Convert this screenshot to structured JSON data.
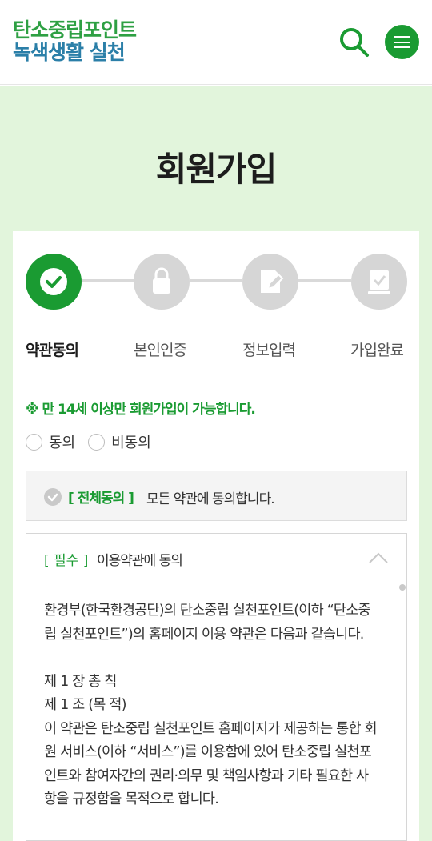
{
  "header": {
    "logo_line1": "탄소중립포인트",
    "logo_line2": "녹색생활 실천"
  },
  "page": {
    "title": "회원가입"
  },
  "steps": [
    {
      "label": "약관동의",
      "icon": "check-icon",
      "active": true
    },
    {
      "label": "본인인증",
      "icon": "lock-icon",
      "active": false
    },
    {
      "label": "정보입력",
      "icon": "edit-icon",
      "active": false
    },
    {
      "label": "가입완료",
      "icon": "complete-icon",
      "active": false
    }
  ],
  "notice": "※ 만 14세 이상만 회원가입이 가능합니다.",
  "age_radio": {
    "agree": "동의",
    "disagree": "비동의"
  },
  "agree_all": {
    "tag": "[ 전체동의 ]",
    "text": "모든 약관에 동의합니다."
  },
  "terms": {
    "tag": "[ 필수 ]",
    "title": "이용약관에 동의",
    "body": "환경부(한국환경공단)의 탄소중립 실천포인트(이하 “탄소중립 실천포인트”)의 홈페이지 이용 약관은 다음과 같습니다.\n\n제 1 장 총 칙\n제 1 조 (목 적)\n이 약관은 탄소중립 실천포인트 홈페이지가 제공하는 통합 회원 서비스(이하 “서비스”)를 이용함에 있어 탄소중립 실천포인트와 참여자간의 권리·의무 및 책임사항과 기타 필요한 사항을 규정함을 목적으로 합니다."
  },
  "colors": {
    "brand_green": "#1a9b32",
    "logo_blue": "#2b7fa8",
    "bg_mint": "#e2f5dc",
    "inactive": "#d6d6d6"
  }
}
